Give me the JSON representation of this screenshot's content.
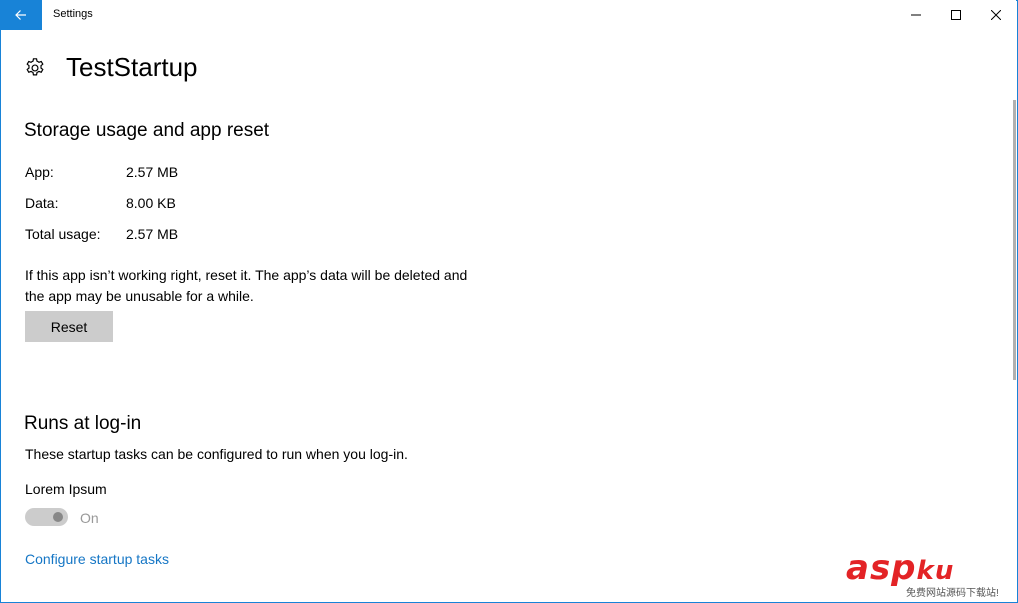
{
  "window": {
    "title": "Settings",
    "accent_color": "#1883d7",
    "controls": {
      "minimize": "minimize-icon",
      "maximize": "maximize-icon",
      "close": "close-icon"
    }
  },
  "app": {
    "name": "TestStartup",
    "icon": "gear-icon"
  },
  "storage": {
    "title": "Storage usage and app reset",
    "rows": [
      {
        "label": "App:",
        "value": "2.57 MB"
      },
      {
        "label": "Data:",
        "value": "8.00 KB"
      },
      {
        "label": "Total usage:",
        "value": "2.57 MB"
      }
    ],
    "description": "If this app isn’t working right, reset it. The app’s data will be deleted and the app may be unusable for a while.",
    "reset_label": "Reset"
  },
  "startup": {
    "title": "Runs at log-in",
    "description": "These startup tasks can be configured to run when you log-in.",
    "task_name": "Lorem Ipsum",
    "toggle_state": "On",
    "toggle_on": true,
    "toggle_disabled": true,
    "configure_link": "Configure startup tasks"
  },
  "watermark": {
    "main": "asp",
    "suffix": "ku",
    "sub": "免费网站源码下载站!"
  }
}
